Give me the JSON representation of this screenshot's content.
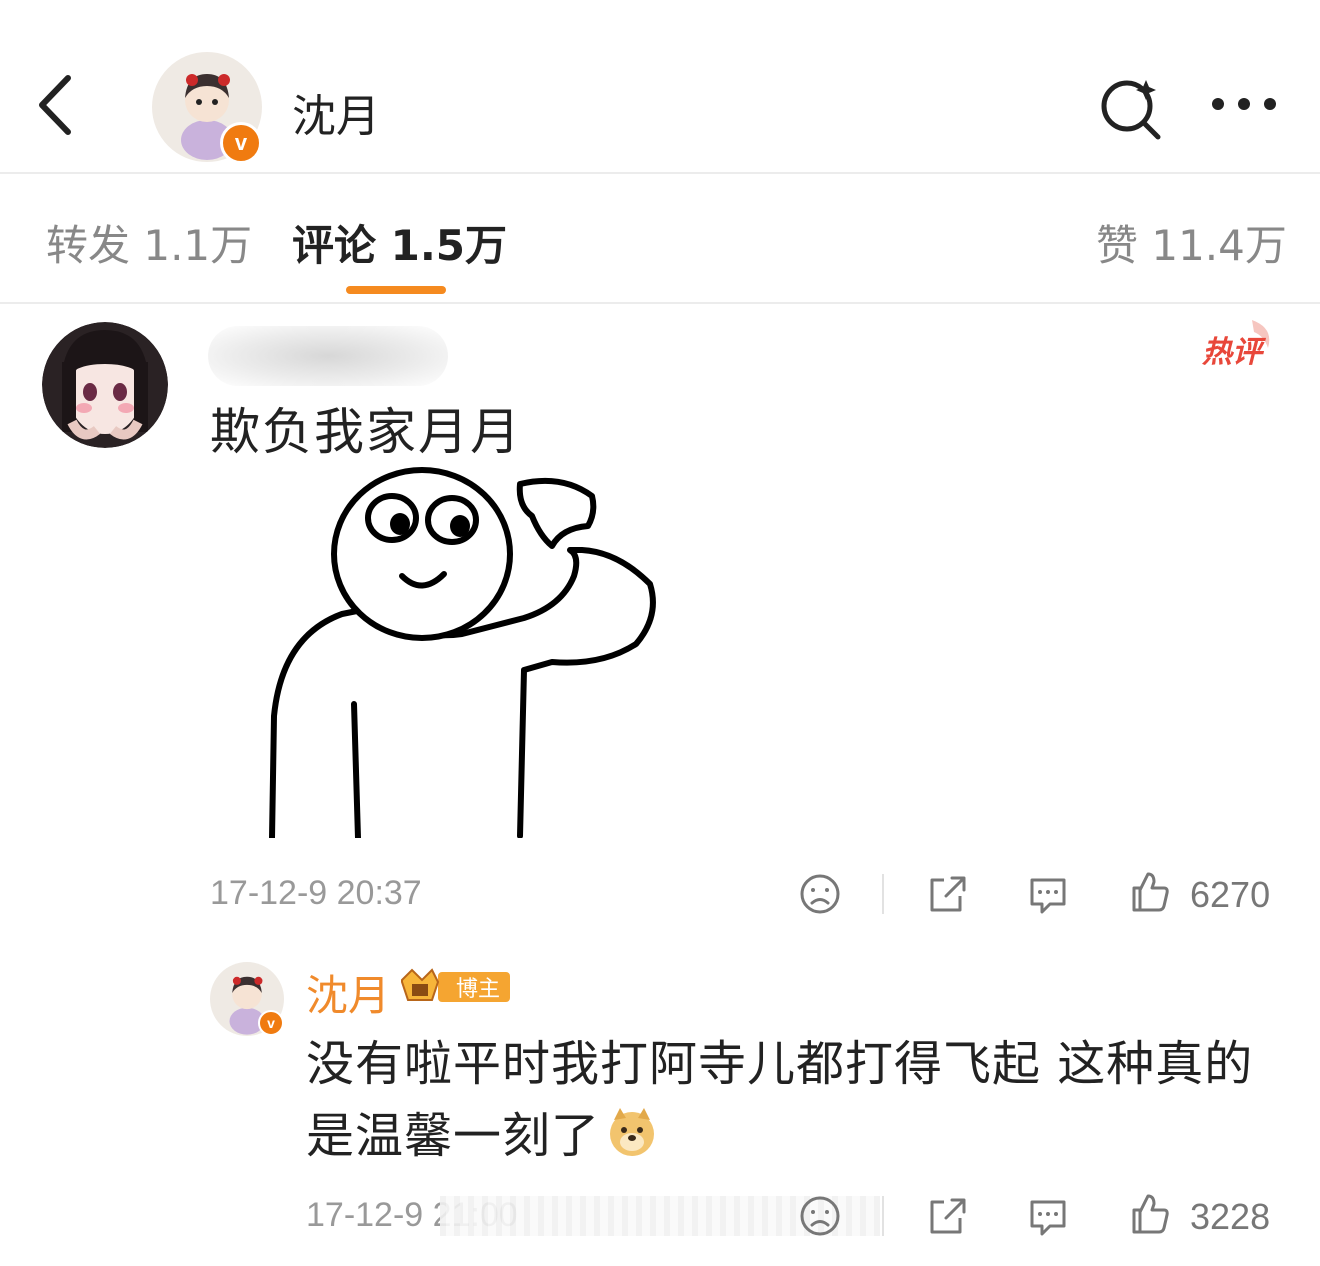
{
  "header": {
    "title": "沈月",
    "verified_badge": "v"
  },
  "tabs": {
    "forward": "转发 1.1万",
    "comment": "评论 1.5万",
    "like": "赞 11.4万"
  },
  "comment": {
    "username": "",
    "hot_label": "热评",
    "text": "欺负我家月月",
    "time": "17-12-9 20:37",
    "like_count": "6270"
  },
  "reply": {
    "username": "沈月",
    "badge_label": "博主",
    "text": "没有啦平时我打阿寺儿都打得飞起 这种真的是温馨一刻了",
    "time": "17-12-9 21:00",
    "like_count": "3228"
  },
  "colors": {
    "accent": "#f58a1f",
    "reply_name": "#f08a2b",
    "hot": "#e8473a",
    "muted": "#999999"
  }
}
